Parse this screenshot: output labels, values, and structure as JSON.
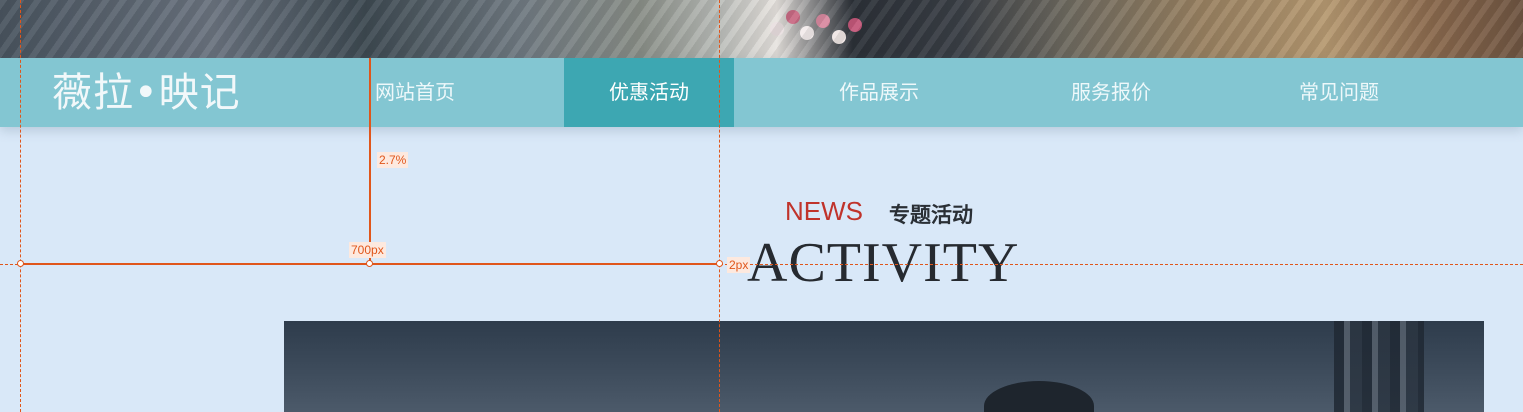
{
  "logo": {
    "text": "薇拉•映记"
  },
  "nav": {
    "items": [
      {
        "label": "网站首页"
      },
      {
        "label": "优惠活动"
      },
      {
        "label": "作品展示"
      },
      {
        "label": "服务报价"
      },
      {
        "label": "常见问题"
      }
    ],
    "active_index": 1
  },
  "section": {
    "news_en": "NEWS",
    "news_cn": "专题活动",
    "activity": "ACTIVITY"
  },
  "measurements": {
    "horizontal_label": "700px",
    "vertical_label": "2.7%",
    "gap_label": "2px"
  },
  "colors": {
    "nav_bg": "#83c6d2",
    "nav_active_bg": "#3da7b2",
    "page_bg": "#d9e8f8",
    "news_red": "#c0332b",
    "measure_orange": "#e0561b"
  }
}
